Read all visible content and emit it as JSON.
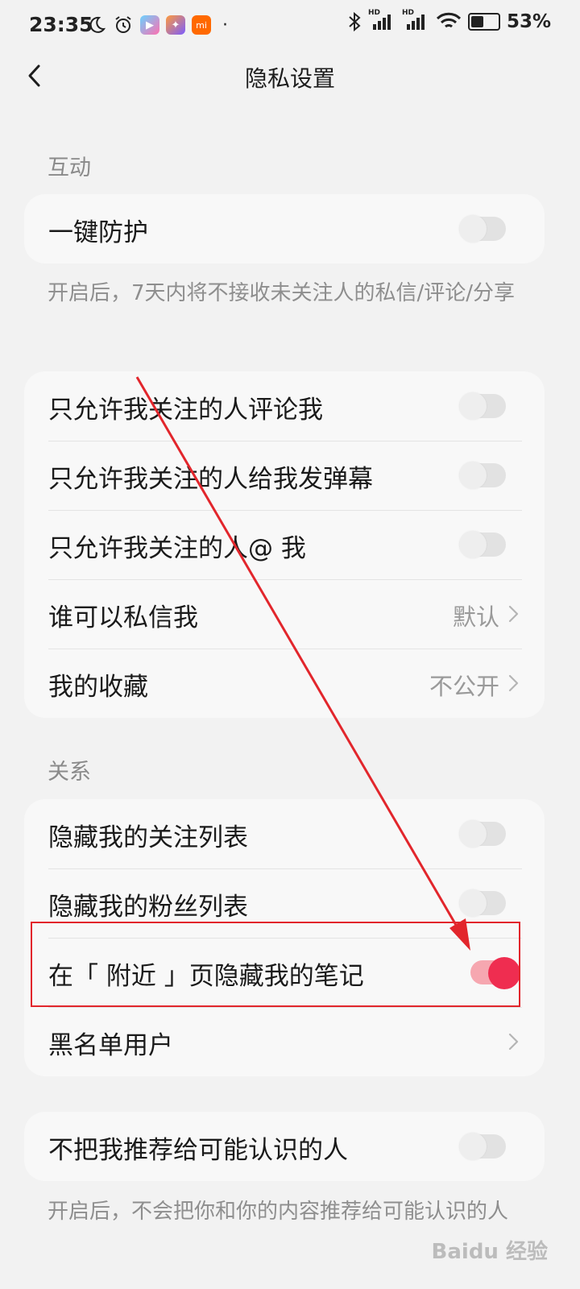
{
  "status_bar": {
    "time": "23:35",
    "battery_percent": "53%",
    "battery_level": 0.53,
    "signal_labels": [
      "HD",
      "HD"
    ]
  },
  "nav": {
    "title": "隐私设置"
  },
  "sections": {
    "interaction_label": "互动",
    "relation_label": "关系"
  },
  "card1": {
    "one_key_protection": {
      "label": "一键防护",
      "on": false
    },
    "description": "开启后，7天内将不接收未关注人的私信/评论/分享"
  },
  "card2": {
    "items": [
      {
        "label": "只允许我关注的人评论我",
        "on": false
      },
      {
        "label": "只允许我关注的人给我发弹幕",
        "on": false
      },
      {
        "label": "只允许我关注的人@ 我",
        "on": false
      },
      {
        "label": "谁可以私信我",
        "value": "默认"
      },
      {
        "label": "我的收藏",
        "value": "不公开"
      }
    ]
  },
  "card3": {
    "items": [
      {
        "label": "隐藏我的关注列表",
        "on": false
      },
      {
        "label": "隐藏我的粉丝列表",
        "on": false
      },
      {
        "label": "在「 附近 」页隐藏我的笔记",
        "on": true
      },
      {
        "label": "黑名单用户"
      }
    ]
  },
  "card4": {
    "item": {
      "label": "不把我推荐给可能认识的人",
      "on": false
    },
    "description": "开启后，不会把你和你的内容推荐给可能认识的人"
  },
  "colors": {
    "accent": "#ef2d50",
    "annotation": "#e2262c"
  },
  "watermark": "Baidu 经验"
}
